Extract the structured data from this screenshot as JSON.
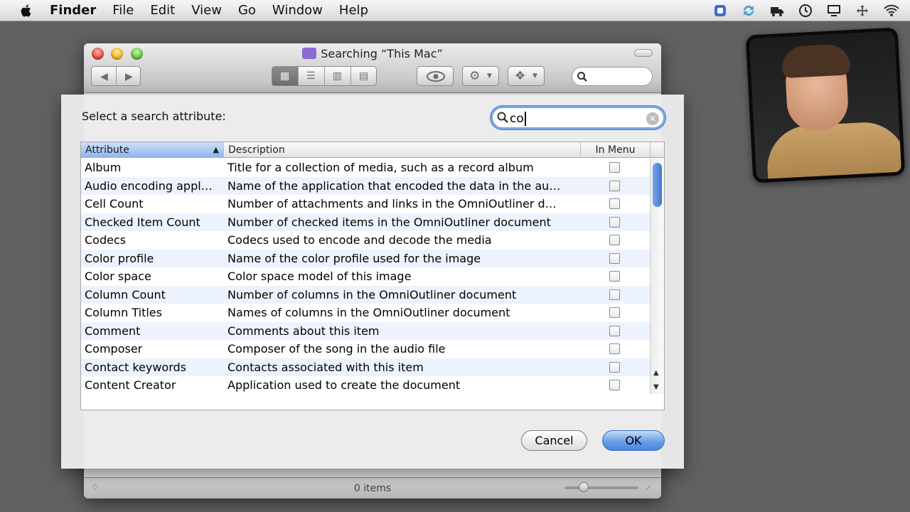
{
  "menubar": {
    "app_name": "Finder",
    "items": [
      "File",
      "Edit",
      "View",
      "Go",
      "Window",
      "Help"
    ]
  },
  "finder": {
    "title": "Searching “This Mac”",
    "status": "0 items"
  },
  "sheet": {
    "prompt": "Select a search attribute:",
    "search_value": "co",
    "columns": {
      "attribute": "Attribute",
      "description": "Description",
      "in_menu": "In Menu"
    },
    "rows": [
      {
        "attribute": "Album",
        "description": "Title for a collection of media, such as a record album"
      },
      {
        "attribute": "Audio encoding appl…",
        "description": "Name of the application that encoded the data in the au…"
      },
      {
        "attribute": "Cell Count",
        "description": "Number of attachments and links in the OmniOutliner d…"
      },
      {
        "attribute": "Checked Item Count",
        "description": "Number of checked items in the OmniOutliner document"
      },
      {
        "attribute": "Codecs",
        "description": "Codecs used to encode and decode the media"
      },
      {
        "attribute": "Color profile",
        "description": "Name of the color profile used for the image"
      },
      {
        "attribute": "Color space",
        "description": "Color space model of this image"
      },
      {
        "attribute": "Column Count",
        "description": "Number of columns in the OmniOutliner document"
      },
      {
        "attribute": "Column Titles",
        "description": "Names of columns in the OmniOutliner document"
      },
      {
        "attribute": "Comment",
        "description": "Comments about this item"
      },
      {
        "attribute": "Composer",
        "description": "Composer of the song in the audio file"
      },
      {
        "attribute": "Contact keywords",
        "description": "Contacts associated with this item"
      },
      {
        "attribute": "Content Creator",
        "description": "Application used to create the document"
      }
    ],
    "cancel_label": "Cancel",
    "ok_label": "OK"
  },
  "icons": {
    "apple": "apple-logo-icon",
    "search": "magnifier-icon",
    "clear": "clear-circle-icon"
  },
  "colors": {
    "selection_blue": "#4f83d1",
    "row_stripe": "#edf3fe",
    "desktop": "#616161"
  }
}
